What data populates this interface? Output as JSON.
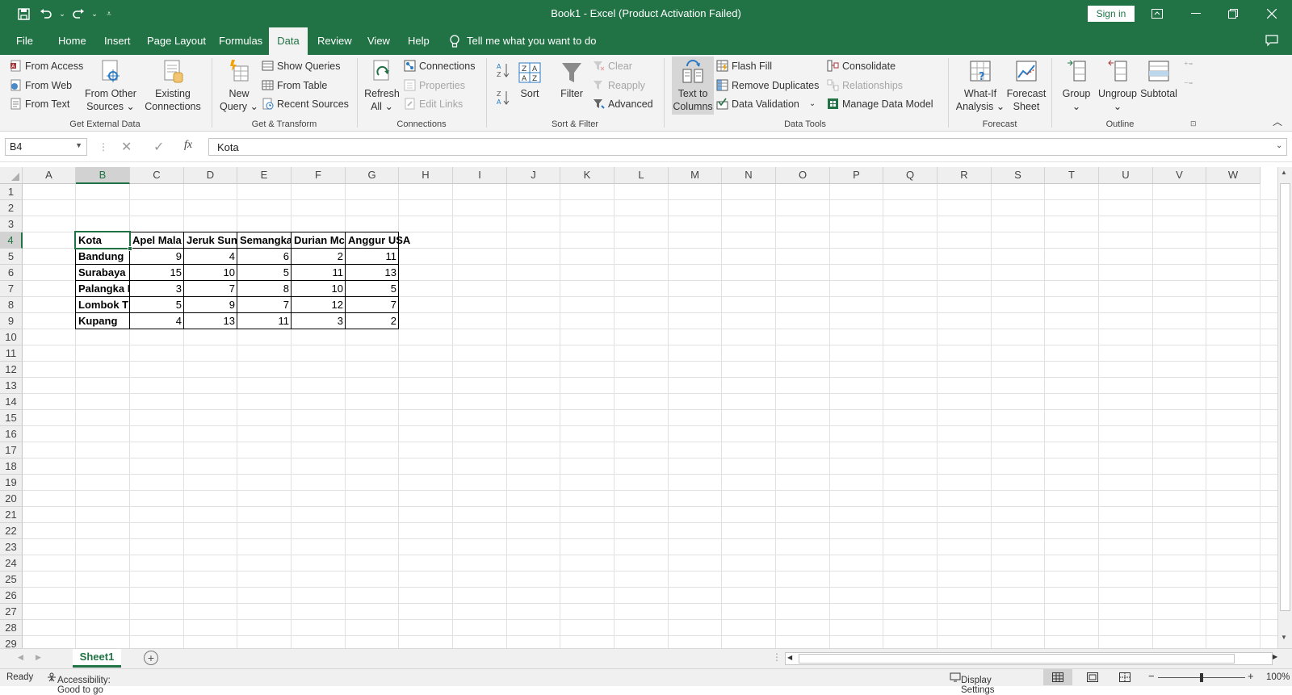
{
  "titlebar": {
    "title": "Book1  -  Excel (Product Activation Failed)",
    "signin": "Sign in"
  },
  "tabs": [
    "File",
    "Home",
    "Insert",
    "Page Layout",
    "Formulas",
    "Data",
    "Review",
    "View",
    "Help"
  ],
  "active_tab": "Data",
  "tellme": "Tell me what you want to do",
  "ribbon": {
    "from_access": "From Access",
    "from_web": "From Web",
    "from_text": "From Text",
    "from_other_1": "From Other",
    "from_other_2": "Sources",
    "existing_1": "Existing",
    "existing_2": "Connections",
    "group_external": "Get External Data",
    "new_query_1": "New",
    "new_query_2": "Query",
    "show_queries": "Show Queries",
    "from_table": "From Table",
    "recent_sources": "Recent Sources",
    "group_transform": "Get & Transform",
    "refresh_1": "Refresh",
    "refresh_2": "All",
    "connections": "Connections",
    "properties": "Properties",
    "edit_links": "Edit Links",
    "group_connections": "Connections",
    "sort": "Sort",
    "filter": "Filter",
    "clear": "Clear",
    "reapply": "Reapply",
    "advanced": "Advanced",
    "group_sort": "Sort & Filter",
    "ttc_1": "Text to",
    "ttc_2": "Columns",
    "flash_fill": "Flash Fill",
    "remove_dup": "Remove Duplicates",
    "data_validation": "Data Validation",
    "consolidate": "Consolidate",
    "relationships": "Relationships",
    "manage_model": "Manage Data Model",
    "group_tools": "Data Tools",
    "whatif_1": "What-If",
    "whatif_2": "Analysis",
    "forecast_1": "Forecast",
    "forecast_2": "Sheet",
    "group_forecast": "Forecast",
    "group_btn": "Group",
    "ungroup_btn": "Ungroup",
    "subtotal": "Subtotal",
    "group_outline": "Outline"
  },
  "formula_bar": {
    "name_box": "B4",
    "fx": "fx",
    "content": "Kota"
  },
  "columns": [
    "A",
    "B",
    "C",
    "D",
    "E",
    "F",
    "G",
    "H",
    "I",
    "J",
    "K",
    "L",
    "M",
    "N",
    "O",
    "P",
    "Q",
    "R",
    "S",
    "T",
    "U",
    "V",
    "W"
  ],
  "rows": [
    "1",
    "2",
    "3",
    "4",
    "5",
    "6",
    "7",
    "8",
    "9",
    "10",
    "11",
    "12",
    "13",
    "14",
    "15",
    "16",
    "17",
    "18",
    "19",
    "20",
    "21",
    "22",
    "23",
    "24",
    "25",
    "26",
    "27",
    "28",
    "29"
  ],
  "table": {
    "headers": [
      "Kota",
      "Apel Mala",
      "Jeruk Sunl",
      "Semangka",
      "Durian Mc",
      "Anggur USA"
    ],
    "rows": [
      {
        "name": "Bandung",
        "values": [
          "9",
          "4",
          "6",
          "2",
          "11"
        ]
      },
      {
        "name": "Surabaya",
        "values": [
          "15",
          "10",
          "5",
          "11",
          "13"
        ]
      },
      {
        "name": "Palangka I",
        "values": [
          "3",
          "7",
          "8",
          "10",
          "5"
        ]
      },
      {
        "name": "Lombok T",
        "values": [
          "5",
          "9",
          "7",
          "12",
          "7"
        ]
      },
      {
        "name": "Kupang",
        "values": [
          "4",
          "13",
          "11",
          "3",
          "2"
        ]
      }
    ]
  },
  "sheet_tab": "Sheet1",
  "status": {
    "ready": "Ready",
    "accessibility": "Accessibility: Good to go",
    "display_settings": "Display Settings",
    "zoom": "100%"
  },
  "colors": {
    "excel_green": "#217346",
    "ribbon_bg": "#f3f3f3"
  }
}
